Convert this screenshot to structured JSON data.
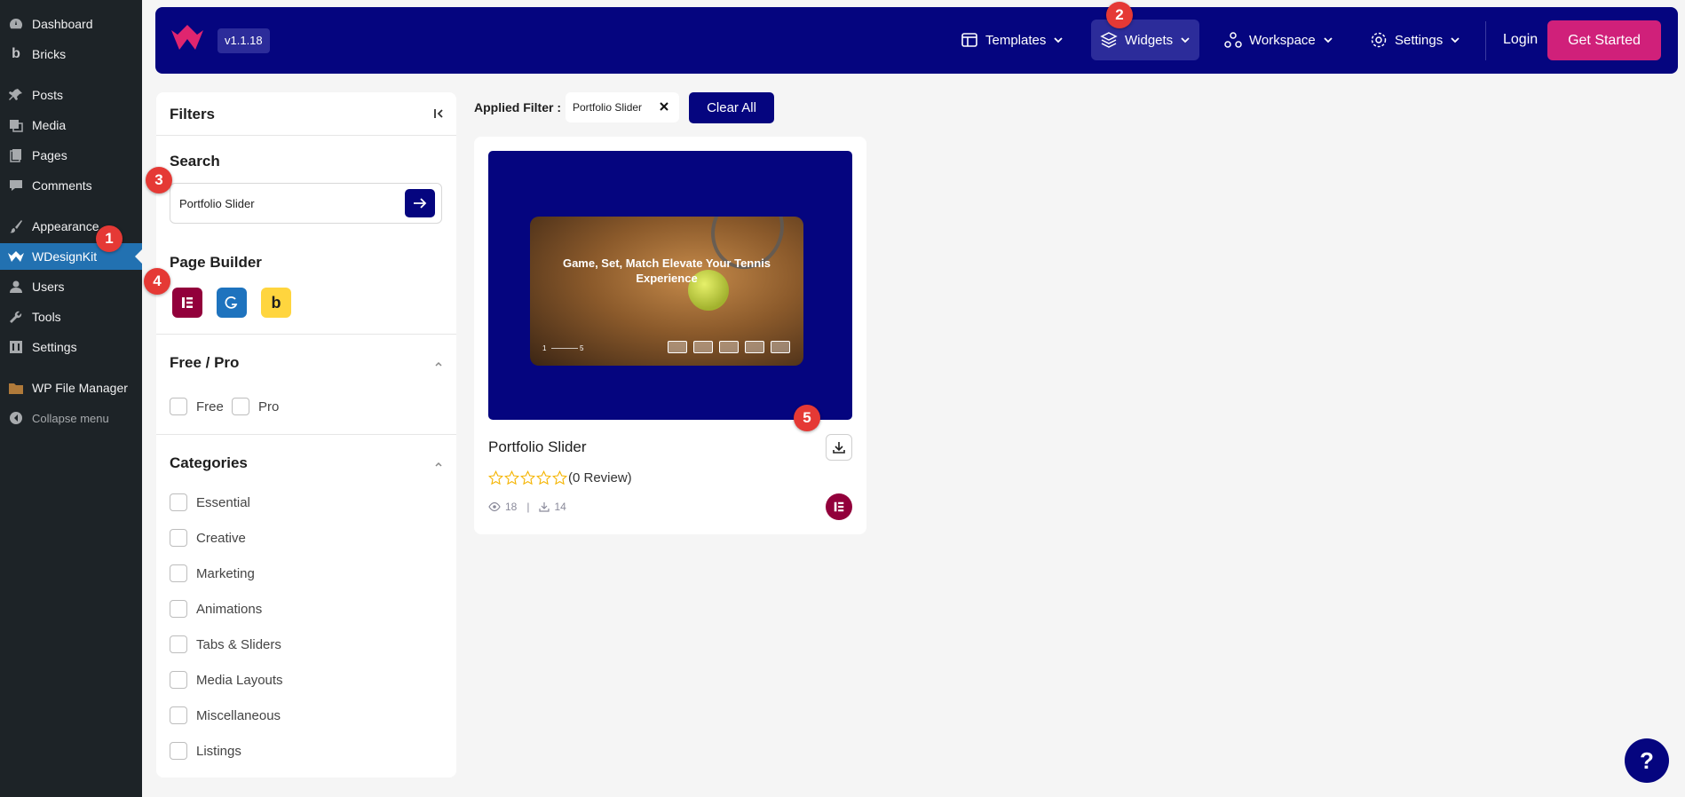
{
  "wp_menu": {
    "items": [
      {
        "label": "Dashboard",
        "icon": "dashboard-icon"
      },
      {
        "label": "Bricks",
        "icon": "bricks-icon"
      },
      {
        "label": "Posts",
        "icon": "pin-icon"
      },
      {
        "label": "Media",
        "icon": "media-icon"
      },
      {
        "label": "Pages",
        "icon": "pages-icon"
      },
      {
        "label": "Comments",
        "icon": "comment-icon"
      },
      {
        "label": "Appearance",
        "icon": "brush-icon"
      },
      {
        "label": "WDesignKit",
        "icon": "wdesignkit-icon"
      },
      {
        "label": "Users",
        "icon": "user-icon"
      },
      {
        "label": "Tools",
        "icon": "wrench-icon"
      },
      {
        "label": "Settings",
        "icon": "settings-icon"
      },
      {
        "label": "WP File Manager",
        "icon": "folder-icon"
      },
      {
        "label": "Collapse menu",
        "icon": "collapse-icon"
      }
    ],
    "active": "WDesignKit"
  },
  "header": {
    "version": "v1.1.18",
    "nav": [
      {
        "label": "Templates",
        "icon": "templates-icon"
      },
      {
        "label": "Widgets",
        "icon": "layers-icon"
      },
      {
        "label": "Workspace",
        "icon": "workspace-icon"
      },
      {
        "label": "Settings",
        "icon": "gear-icon"
      }
    ],
    "login": "Login",
    "cta": "Get Started"
  },
  "filters": {
    "title": "Filters",
    "search": {
      "title": "Search",
      "value": "Portfolio Slider"
    },
    "page_builder": {
      "title": "Page Builder",
      "builders": [
        "elementor",
        "gutenberg",
        "bricks"
      ],
      "bricks_letter": "b"
    },
    "free_pro": {
      "title": "Free / Pro",
      "options": [
        "Free",
        "Pro"
      ]
    },
    "categories": {
      "title": "Categories",
      "options": [
        "Essential",
        "Creative",
        "Marketing",
        "Animations",
        "Tabs & Sliders",
        "Media Layouts",
        "Miscellaneous",
        "Listings"
      ]
    }
  },
  "applied": {
    "label": "Applied Filter :",
    "chip": "Portfolio Slider",
    "clear": "Clear All"
  },
  "card": {
    "title": "Portfolio Slider",
    "preview_headline": "Game, Set, Match Elevate Your Tennis Experience",
    "preview_page_start": "1",
    "preview_page_end": "5",
    "rating": 0,
    "reviews": "(0 Review)",
    "views": "18",
    "meta_separator": "|",
    "downloads": "14"
  },
  "markers": [
    "1",
    "2",
    "3",
    "4",
    "5"
  ],
  "help": "?",
  "colors": {
    "brand": "#05057f",
    "cta": "#d0207a",
    "wp_active": "#2271b1",
    "marker": "#e53935",
    "elementor": "#92003b",
    "gutenberg": "#1e73be",
    "bricks": "#ffd53e"
  }
}
